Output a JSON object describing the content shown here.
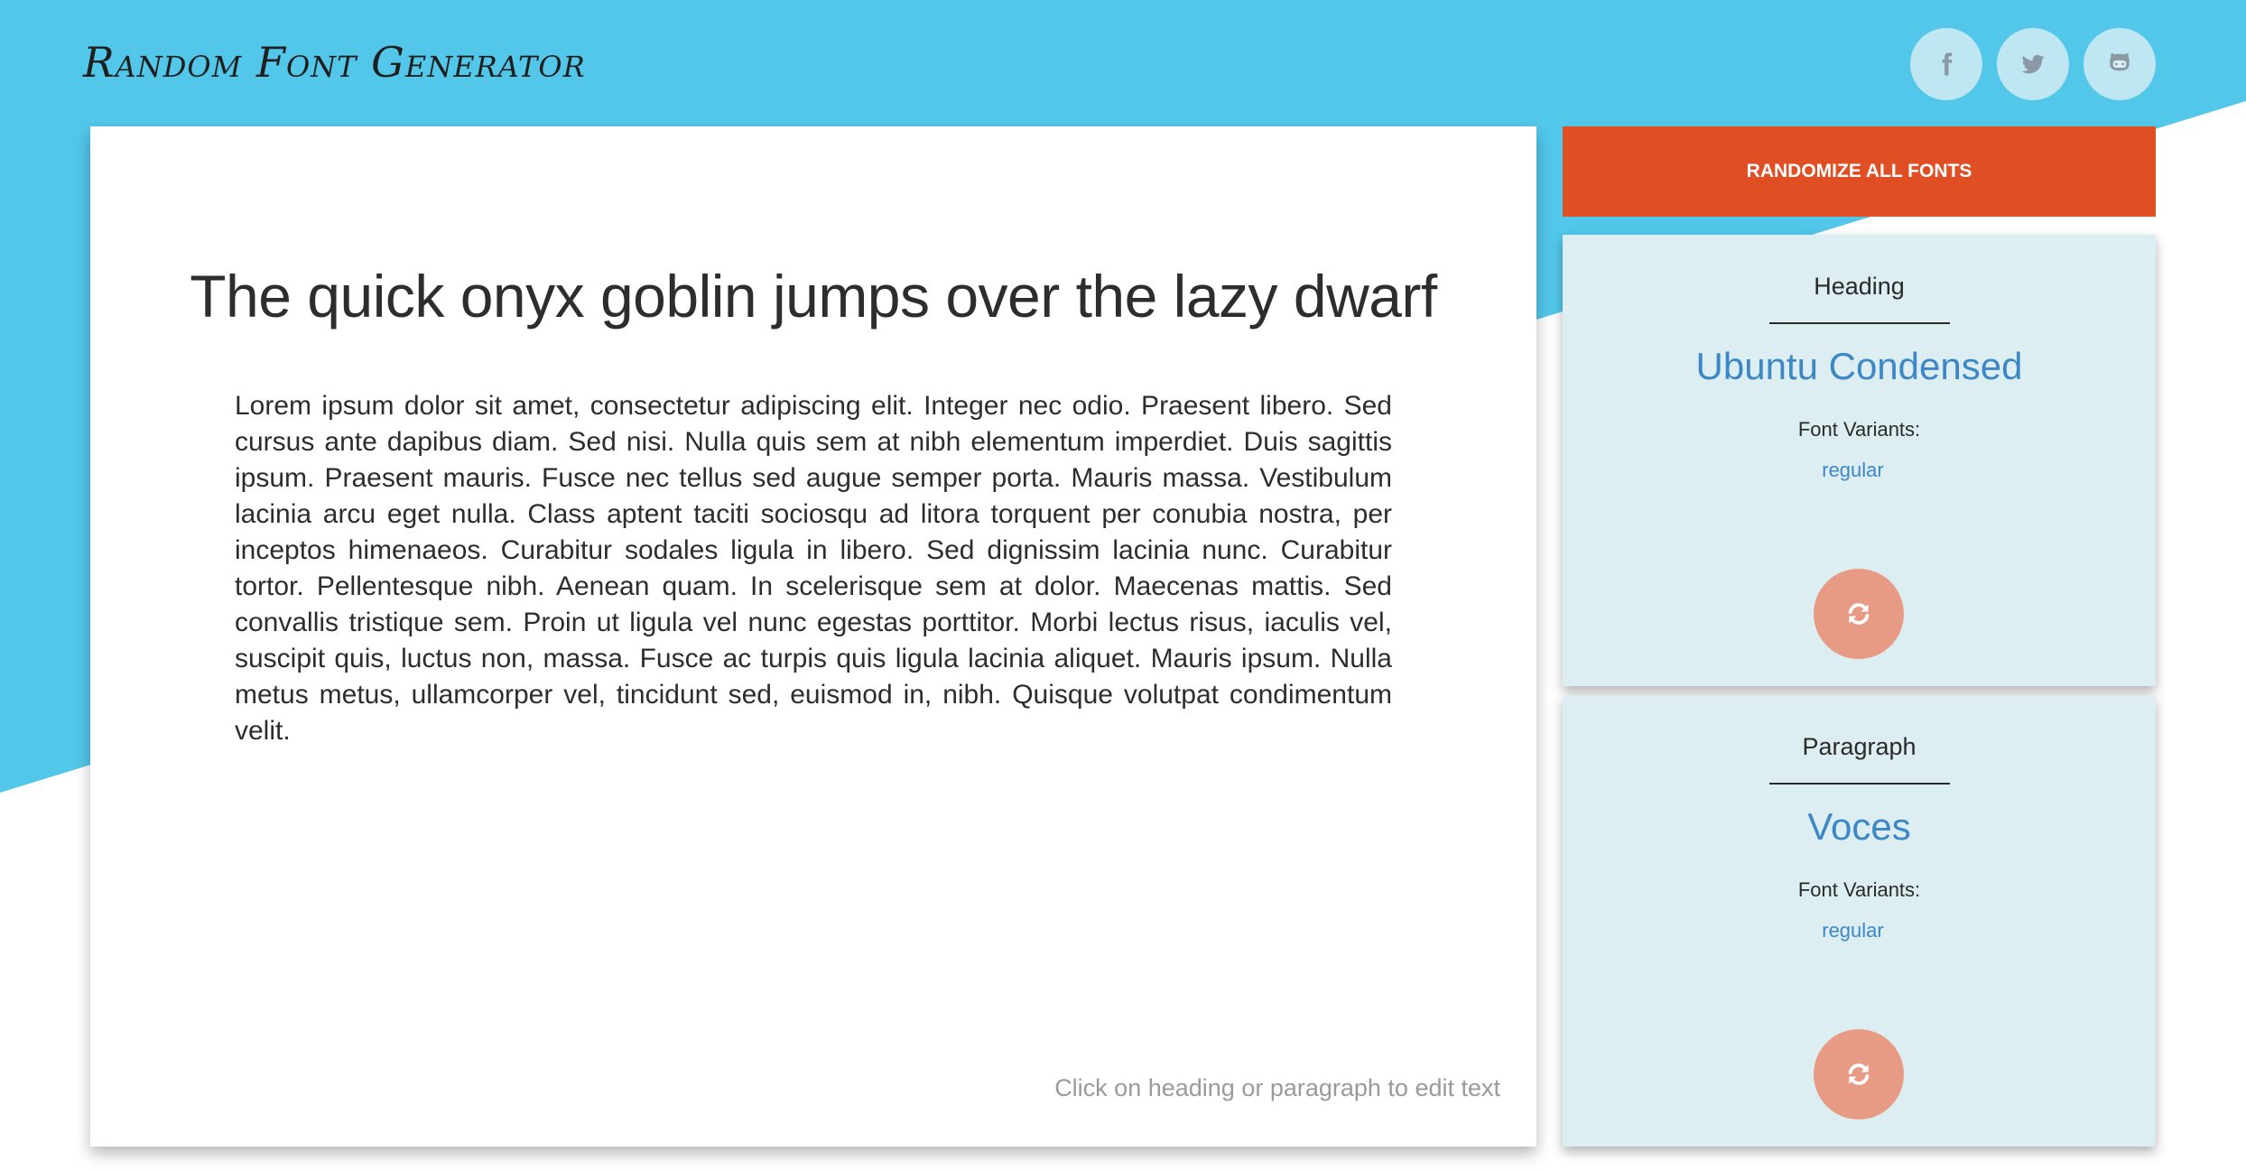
{
  "app": {
    "logo_text": "Random Font Generator"
  },
  "social": [
    {
      "icon": "facebook-icon"
    },
    {
      "icon": "twitter-icon"
    },
    {
      "icon": "github-icon"
    }
  ],
  "editor": {
    "heading_text": "The quick onyx goblin jumps over the lazy dwarf",
    "paragraph_text": "Lorem ipsum dolor sit amet, consectetur adipiscing elit. Integer nec odio. Praesent libero. Sed cursus ante dapibus diam. Sed nisi. Nulla quis sem at nibh elementum imperdiet. Duis sagittis ipsum. Praesent mauris. Fusce nec tellus sed augue semper porta. Mauris massa. Vestibulum lacinia arcu eget nulla. Class aptent taciti sociosqu ad litora torquent per conubia nostra, per inceptos himenaeos. Curabitur sodales ligula in libero. Sed dignissim lacinia nunc. Curabitur tortor. Pellentesque nibh. Aenean quam. In scelerisque sem at dolor. Maecenas mattis. Sed convallis tristique sem. Proin ut ligula vel nunc egestas porttitor. Morbi lectus risus, iaculis vel, suscipit quis, luctus non, massa. Fusce ac turpis quis ligula lacinia aliquet. Mauris ipsum. Nulla metus metus, ullamcorper vel, tincidunt sed, euismod in, nibh. Quisque volutpat condimentum velit.",
    "hint": "Click on heading or paragraph to edit text"
  },
  "controls": {
    "randomize_label": "RANDOMIZE ALL FONTS"
  },
  "heading_card": {
    "label": "Heading",
    "font_name": "Ubuntu Condensed",
    "variants_label": "Font Variants:",
    "variants": [
      "regular"
    ],
    "refresh_icon": "refresh-icon"
  },
  "paragraph_card": {
    "label": "Paragraph",
    "font_name": "Voces",
    "variants_label": "Font Variants:",
    "variants": [
      "regular"
    ],
    "refresh_icon": "refresh-icon"
  },
  "colors": {
    "header_blue": "#53c7ea",
    "randomize_orange": "#e04e24",
    "link_blue": "#3d87c6",
    "card_bg": "#ddeef2",
    "refresh_salmon": "#e79a84"
  }
}
